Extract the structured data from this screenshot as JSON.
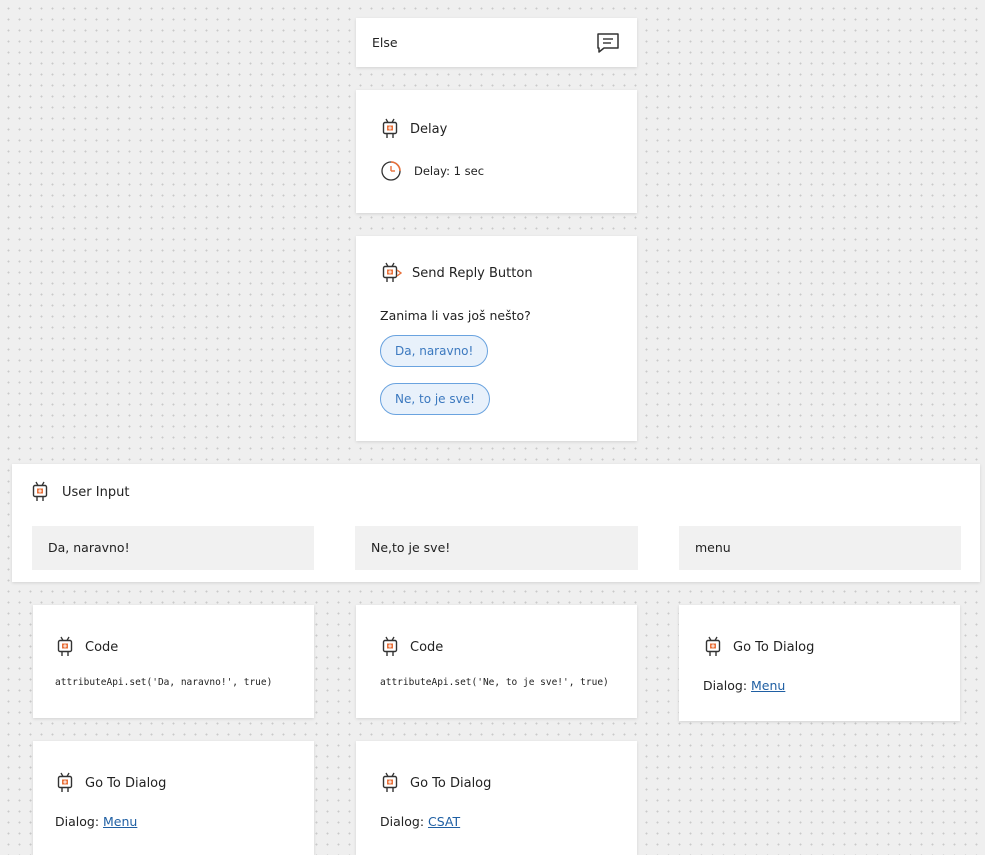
{
  "else_card": {
    "label": "Else",
    "icon": "chat-icon"
  },
  "delay_card": {
    "title": "Delay",
    "detail": "Delay: 1 sec",
    "icon": "clock-icon"
  },
  "reply_card": {
    "title": "Send Reply Button",
    "question": "Zanima li vas još nešto?",
    "buttons": [
      "Da, naravno!",
      "Ne, to je sve!"
    ]
  },
  "user_input": {
    "title": "User Input",
    "options": [
      "Da, naravno!",
      "Ne,to je sve!",
      "menu"
    ]
  },
  "code_cards": [
    {
      "title": "Code",
      "code": "attributeApi.set('Da, naravno!', true)"
    },
    {
      "title": "Code",
      "code": "attributeApi.set('Ne, to je sve!', true)"
    }
  ],
  "goto_cards": [
    {
      "title": "Go To Dialog",
      "prefix": "Dialog:",
      "target": "Menu"
    },
    {
      "title": "Go To Dialog",
      "prefix": "Dialog:",
      "target": "Menu"
    },
    {
      "title": "Go To Dialog",
      "prefix": "Dialog:",
      "target": "CSAT"
    }
  ],
  "colors": {
    "accent_orange": "#e8703a",
    "chip_border": "#6aa3df",
    "link": "#1f5fa3"
  }
}
